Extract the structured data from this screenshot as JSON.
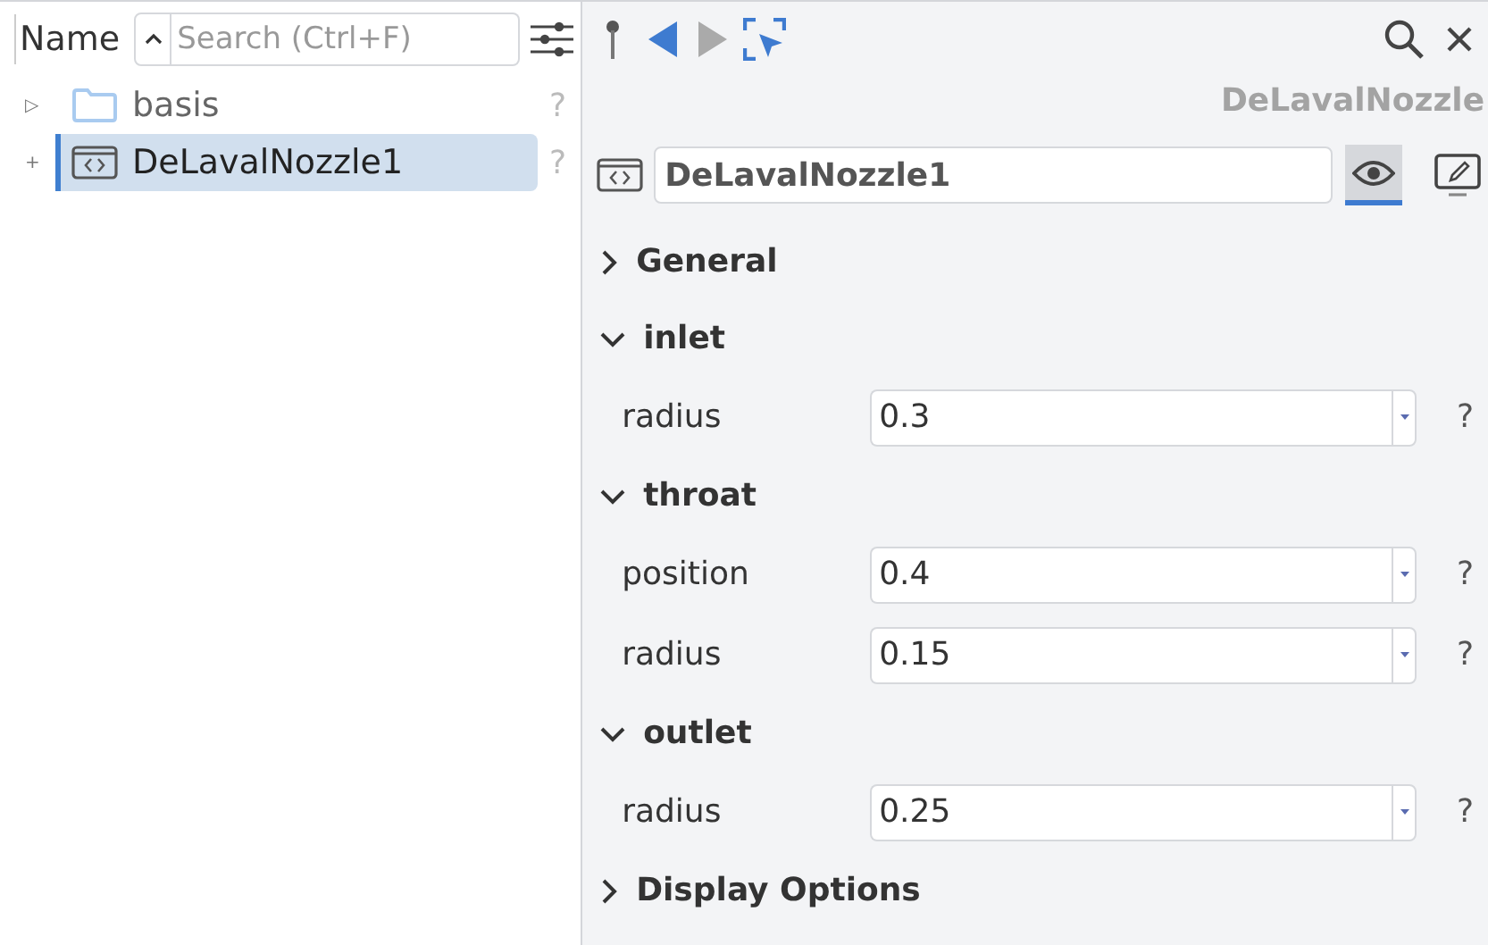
{
  "tree": {
    "column": "Name",
    "search": {
      "placeholder": "Search (Ctrl+F)"
    },
    "items": [
      {
        "expander": "▷",
        "kind": "folder",
        "label": "basis",
        "help": "?",
        "selected": false
      },
      {
        "expander": "+",
        "kind": "component",
        "label": "DeLavalNozzle1",
        "help": "?",
        "selected": true
      }
    ]
  },
  "inspector": {
    "type_title": "DeLavalNozzle",
    "name_value": "DeLavalNozzle1",
    "view_mode_selected": true,
    "sections": [
      {
        "title": "General",
        "expanded": false
      },
      {
        "title": "inlet",
        "expanded": true,
        "fields": [
          {
            "label": "radius",
            "value": "0.3",
            "help": "?"
          }
        ]
      },
      {
        "title": "throat",
        "expanded": true,
        "fields": [
          {
            "label": "position",
            "value": "0.4",
            "help": "?"
          },
          {
            "label": "radius",
            "value": "0.15",
            "help": "?"
          }
        ]
      },
      {
        "title": "outlet",
        "expanded": true,
        "fields": [
          {
            "label": "radius",
            "value": "0.25",
            "help": "?"
          }
        ]
      },
      {
        "title": "Display Options",
        "expanded": false
      }
    ]
  }
}
